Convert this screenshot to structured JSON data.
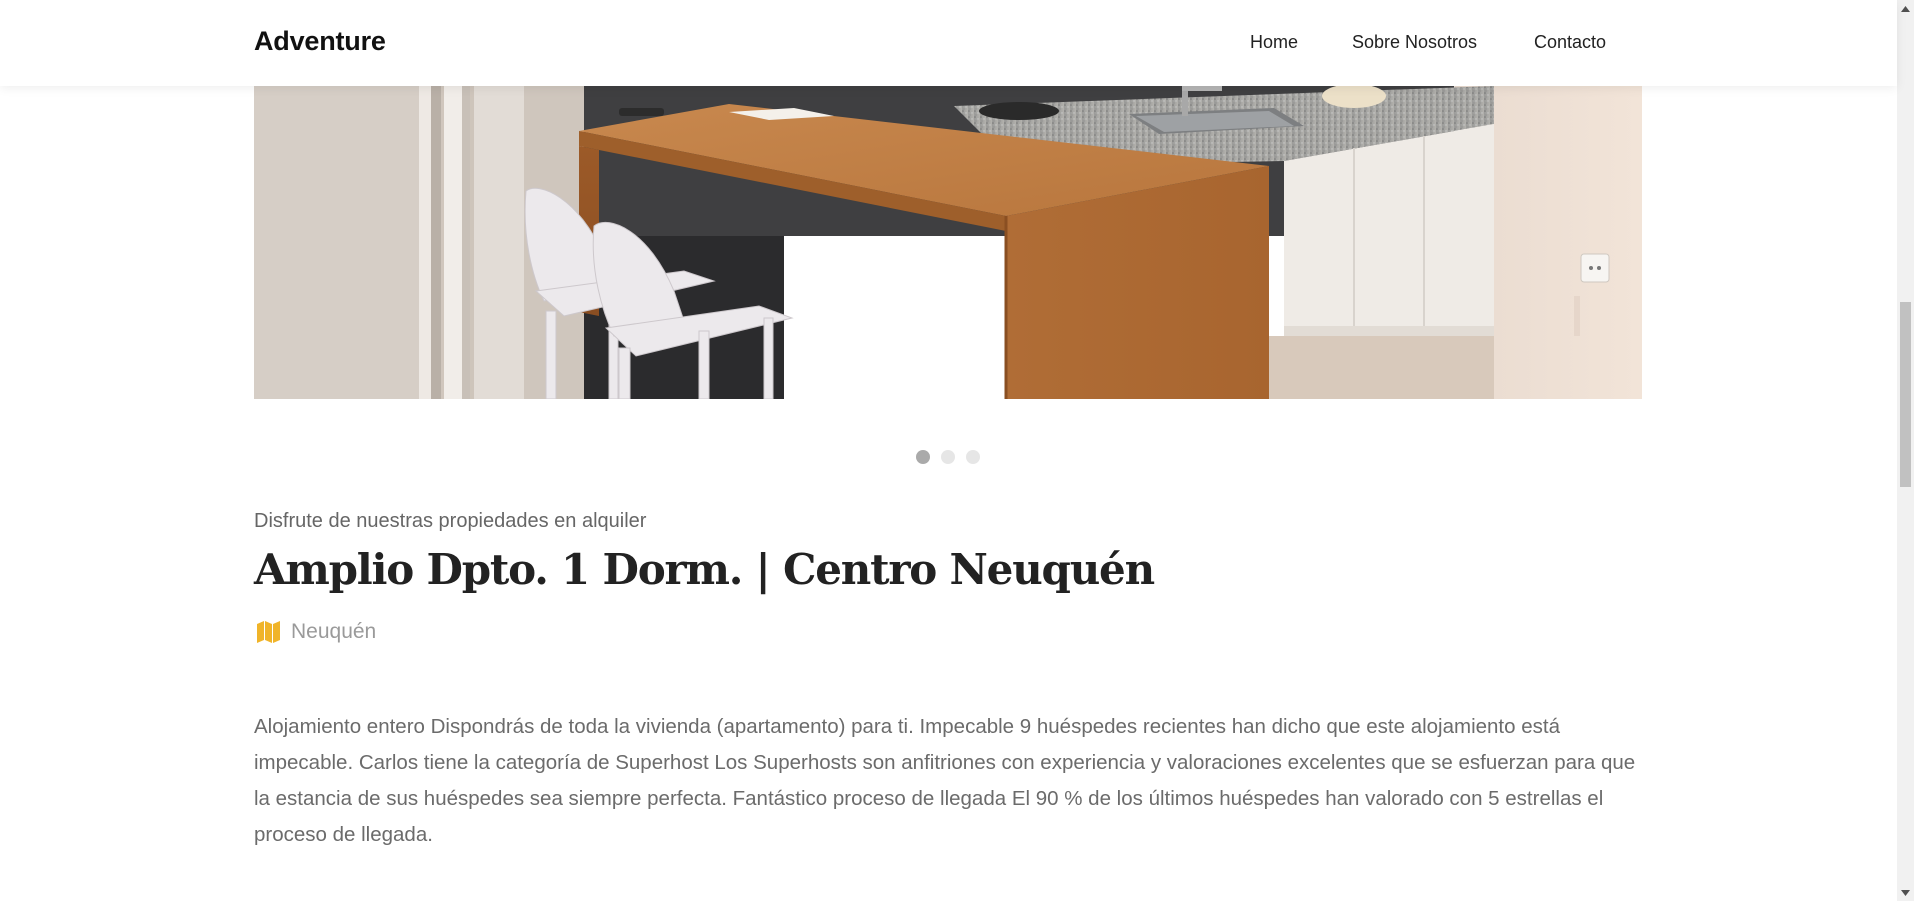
{
  "navbar": {
    "brand": "Adventure",
    "links": [
      {
        "label": "Home"
      },
      {
        "label": "Sobre Nosotros"
      },
      {
        "label": "Contacto"
      }
    ]
  },
  "carousel": {
    "slide_count": 3,
    "active_index": 0
  },
  "listing": {
    "subtitle": "Disfrute de nuestras propiedades en alquiler",
    "title": "Amplio Dpto. 1 Dorm. | Centro Neuquén",
    "location": "Neuquén",
    "location_icon": "map-icon",
    "description": "Alojamiento entero Dispondrás de toda la vivienda (apartamento) para ti. Impecable 9 huéspedes recientes han dicho que este alojamiento está impecable. Carlos tiene la categoría de Superhost Los Superhosts son anfitriones con experiencia y valoraciones excelentes que se esfuerzan para que la estancia de sus huéspedes sea siempre perfecta. Fantástico proceso de llegada El 90 % de los últimos huéspedes han valorado con 5 estrellas el proceso de llegada."
  },
  "colors": {
    "accent_icon": "#f0b429",
    "title_text": "#222222",
    "body_text": "#6b6b6b"
  }
}
